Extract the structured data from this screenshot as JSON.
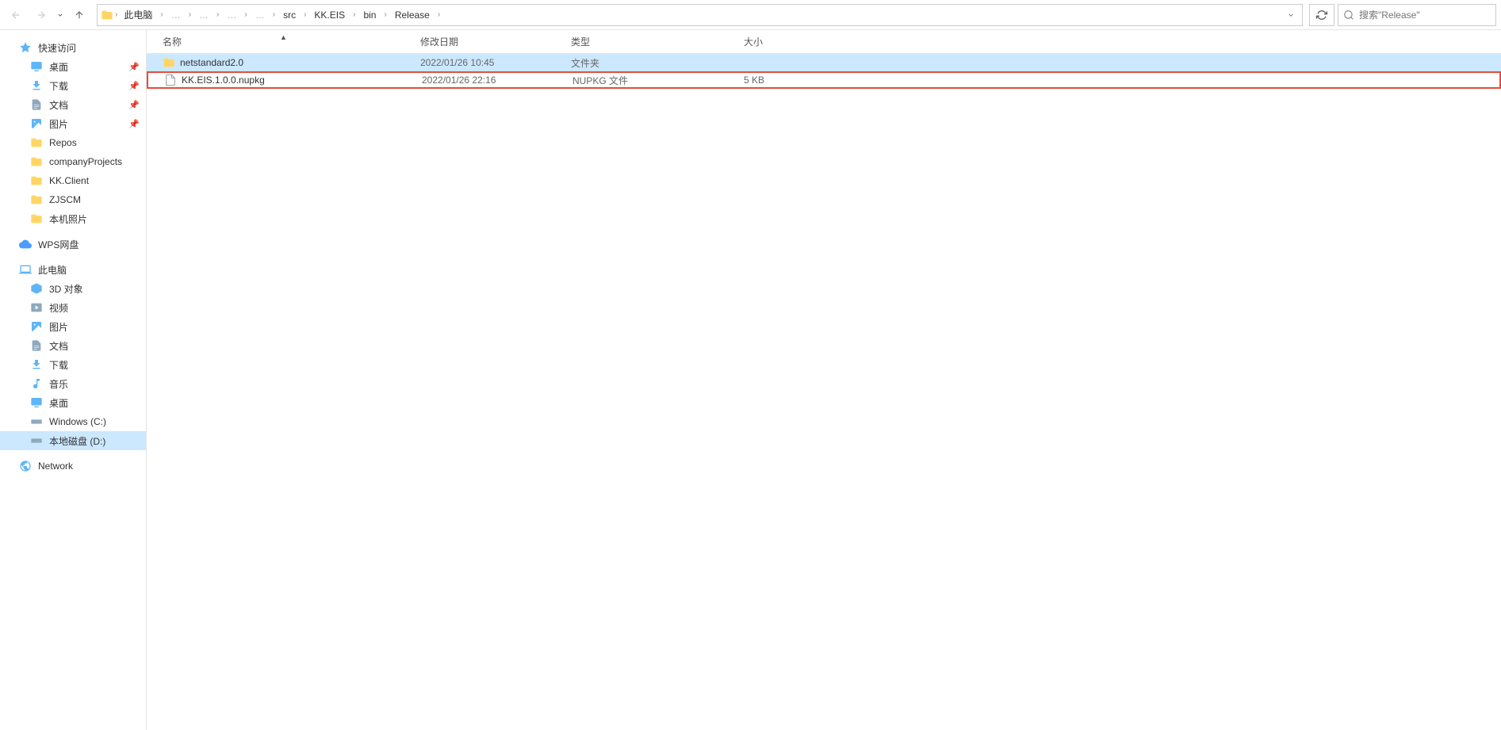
{
  "toolbar": {
    "breadcrumb": [
      "此电脑",
      "",
      "",
      "",
      "",
      "",
      "src",
      "KK.EIS",
      "bin",
      "Release"
    ],
    "search_placeholder": "搜索\"Release\""
  },
  "sidebar": {
    "quick_access": "快速访问",
    "quick_items": [
      {
        "label": "桌面",
        "icon": "desktop",
        "pinned": true
      },
      {
        "label": "下载",
        "icon": "download",
        "pinned": true
      },
      {
        "label": "文档",
        "icon": "document",
        "pinned": true
      },
      {
        "label": "图片",
        "icon": "picture",
        "pinned": true
      },
      {
        "label": "Repos",
        "icon": "folder",
        "pinned": false
      },
      {
        "label": "companyProjects",
        "icon": "folder",
        "pinned": false
      },
      {
        "label": "KK.Client",
        "icon": "folder",
        "pinned": false
      },
      {
        "label": "ZJSCM",
        "icon": "folder",
        "pinned": false
      },
      {
        "label": "本机照片",
        "icon": "folder",
        "pinned": false
      }
    ],
    "wps": "WPS网盘",
    "this_pc": "此电脑",
    "pc_items": [
      {
        "label": "3D 对象",
        "icon": "3d"
      },
      {
        "label": "视频",
        "icon": "video"
      },
      {
        "label": "图片",
        "icon": "picture"
      },
      {
        "label": "文档",
        "icon": "document"
      },
      {
        "label": "下载",
        "icon": "download"
      },
      {
        "label": "音乐",
        "icon": "music"
      },
      {
        "label": "桌面",
        "icon": "desktop"
      },
      {
        "label": "Windows (C:)",
        "icon": "drive"
      },
      {
        "label": "本地磁盘 (D:)",
        "icon": "drive",
        "selected": true
      }
    ],
    "network": "Network"
  },
  "columns": {
    "name": "名称",
    "date": "修改日期",
    "type": "类型",
    "size": "大小"
  },
  "files": [
    {
      "name": "netstandard2.0",
      "date": "2022/01/26 10:45",
      "type": "文件夹",
      "size": "",
      "icon": "folder",
      "selected": true,
      "highlighted": false
    },
    {
      "name": "KK.EIS.1.0.0.nupkg",
      "date": "2022/01/26 22:16",
      "type": "NUPKG 文件",
      "size": "5 KB",
      "icon": "file",
      "selected": false,
      "highlighted": true
    }
  ]
}
